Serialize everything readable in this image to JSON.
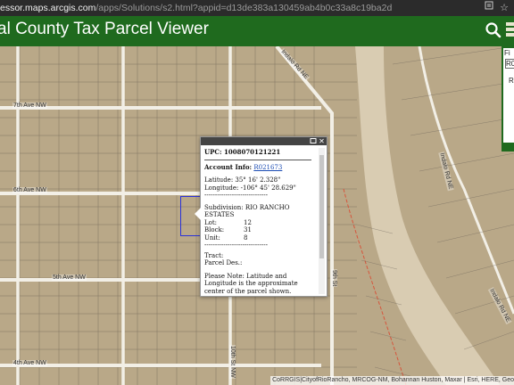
{
  "browser": {
    "url_host": "essor.maps.arcgis.com",
    "url_path": "/apps/Solutions/s2.html?appid=d13de383a130459ab4b0c33a8c19ba2d",
    "icons": [
      "page-info-icon",
      "favorite-star-icon"
    ]
  },
  "app": {
    "title": "al County Tax Parcel Viewer",
    "icons": [
      "search-icon",
      "layers-icon"
    ]
  },
  "side_panel": {
    "label_top": "Fi",
    "input_value": "R0",
    "label_r": "R"
  },
  "map": {
    "streets": {
      "seventh": "7th Ave NW",
      "sixth": "6th Ave NW",
      "fifth": "5th Ave NW",
      "fourth": "4th Ave NW",
      "tenth": "10th St NW",
      "ninth": "9th St",
      "indalo": "Indalo Rd NE",
      "indalo2": "Indalo Rd NE",
      "indalo3": "Indalo Rd NE"
    },
    "attribution": "CoRRGIS|CityofRioRancho, MRCOG-NM, Bohannan Huston, Maxar | Esri, HERE, Geo"
  },
  "popup": {
    "upc": "UPC: 1008070121221",
    "account_label": "Account Info:",
    "account_link": "R021673",
    "latitude": "Latitude: 35° 16' 2.328\"",
    "longitude": "Longitude: -106° 45' 28.629\"",
    "divider": "------------------------------",
    "subdivision": "Subdivision: RIO RANCHO ESTATES",
    "lot_label": "Lot:",
    "lot_value": "12",
    "block_label": "Block:",
    "block_value": "31",
    "unit_label": "Unit:",
    "unit_value": "8",
    "divider2": "------------------------------",
    "tract": "Tract:",
    "parcel_des": "Parcel Des.:",
    "note": "Please Note: Latitude and Longitude is the approximate center of the parcel shown.",
    "header_icons": [
      "maximize-icon",
      "close-icon"
    ]
  }
}
